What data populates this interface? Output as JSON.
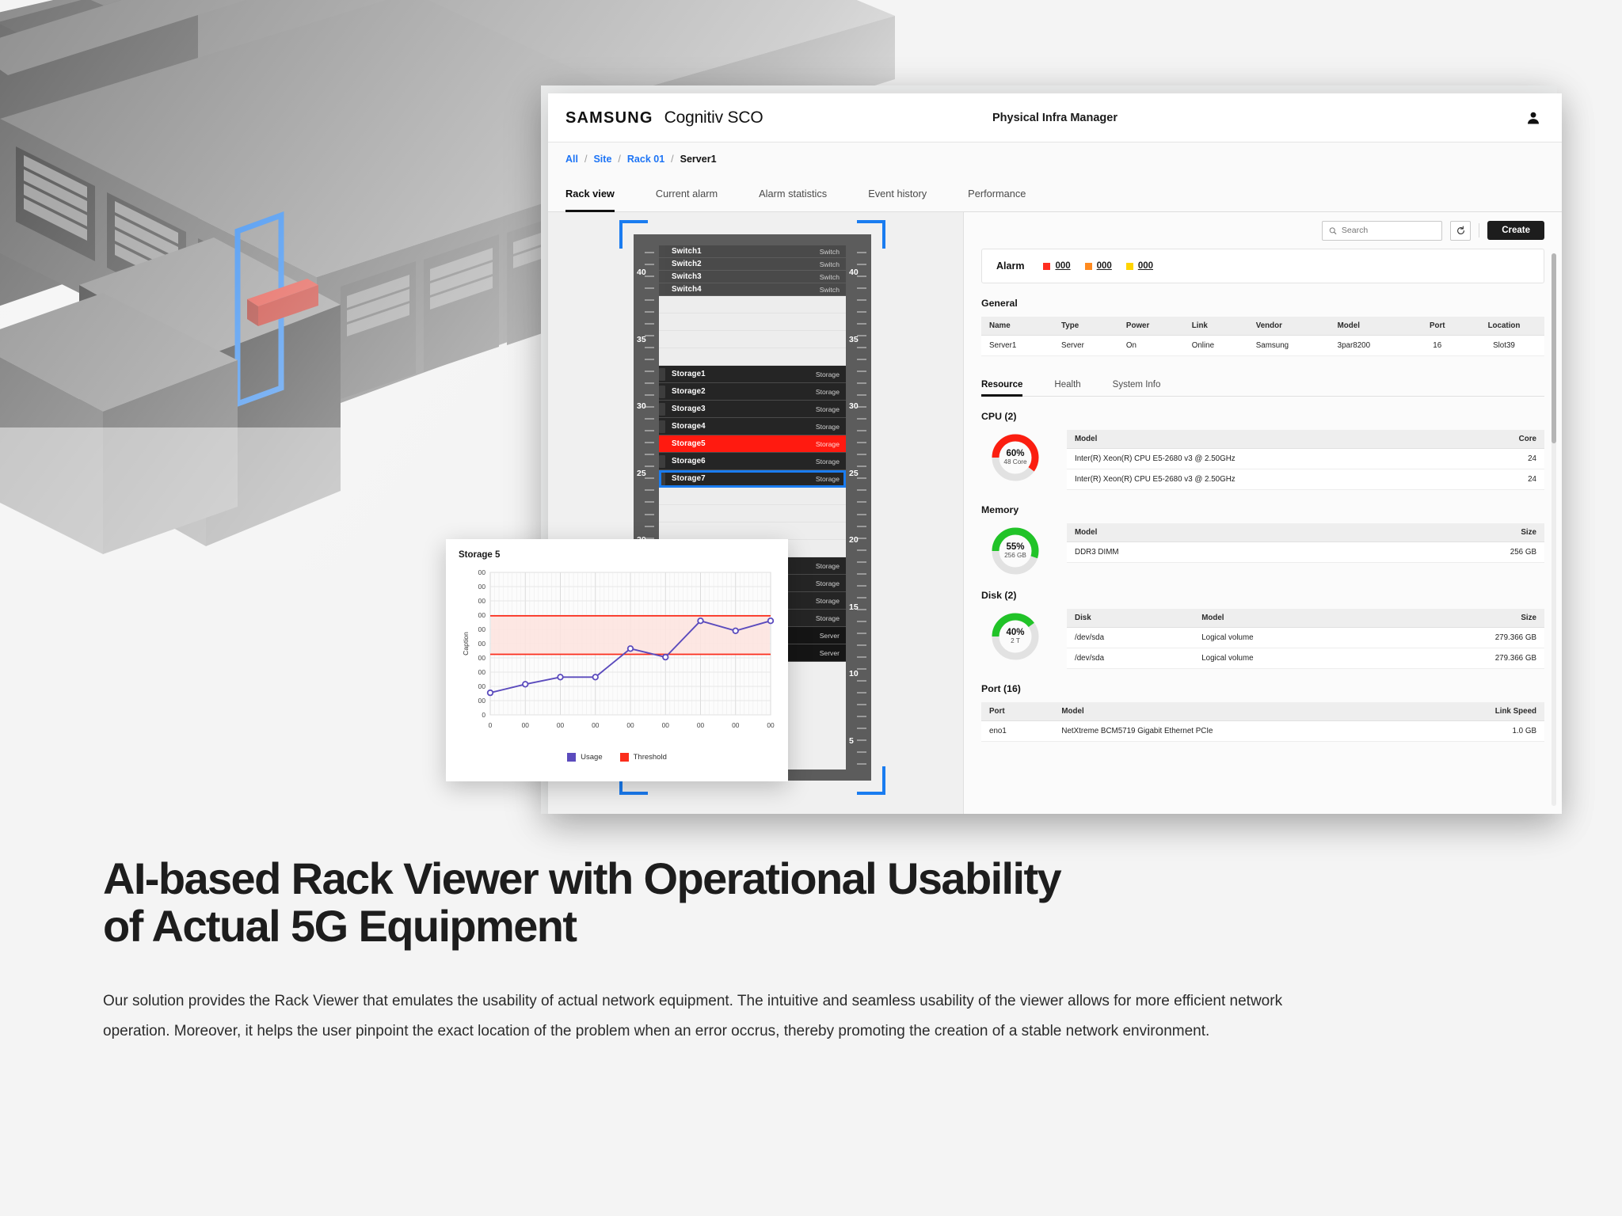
{
  "app": {
    "brand_samsung": "SAMSUNG",
    "brand_product": "Cognitiv SCO",
    "header_title": "Physical Infra Manager",
    "avatar_name": "user-avatar"
  },
  "breadcrumb": {
    "items": [
      "All",
      "Site",
      "Rack 01",
      "Server1"
    ],
    "separator": "/"
  },
  "tabs": [
    {
      "label": "Rack view",
      "active": true
    },
    {
      "label": "Current alarm",
      "active": false
    },
    {
      "label": "Alarm statistics",
      "active": false
    },
    {
      "label": "Event history",
      "active": false
    },
    {
      "label": "Performance",
      "active": false
    }
  ],
  "toolbar": {
    "search_placeholder": "Search",
    "search_value": "",
    "refresh_label": "↺",
    "create_label": "Create"
  },
  "alarm": {
    "title": "Alarm",
    "items": [
      {
        "color": "#ff2d20",
        "value": "000"
      },
      {
        "color": "#ff8a1f",
        "value": "000"
      },
      {
        "color": "#ffd400",
        "value": "000"
      }
    ]
  },
  "general": {
    "title": "General",
    "columns": [
      "Name",
      "Type",
      "Power",
      "Link",
      "Vendor",
      "Model",
      "Port",
      "Location"
    ],
    "rows": [
      [
        "Server1",
        "Server",
        "On",
        "Online",
        "Samsung",
        "3par8200",
        "16",
        "Slot39"
      ]
    ]
  },
  "subtabs": [
    {
      "label": "Resource",
      "active": true
    },
    {
      "label": "Health",
      "active": false
    },
    {
      "label": "System Info",
      "active": false
    }
  ],
  "cpu": {
    "title": "CPU (2)",
    "percent": "60%",
    "percent_value": 60,
    "sub": "48 Core",
    "ring_color": "#fb1e10",
    "columns": [
      "Model",
      "Core"
    ],
    "rows": [
      [
        "Inter(R) Xeon(R) CPU E5-2680 v3 @ 2.50GHz",
        "24"
      ],
      [
        "Inter(R) Xeon(R) CPU E5-2680 v3 @ 2.50GHz",
        "24"
      ]
    ]
  },
  "memory": {
    "title": "Memory",
    "percent": "55%",
    "percent_value": 55,
    "sub": "256 GB",
    "ring_color": "#21c328",
    "columns": [
      "Model",
      "Size"
    ],
    "rows": [
      [
        "DDR3 DIMM",
        "256 GB"
      ]
    ]
  },
  "disk": {
    "title": "Disk (2)",
    "percent": "40%",
    "percent_value": 40,
    "sub": "2 T",
    "ring_color": "#21c328",
    "columns": [
      "Disk",
      "Model",
      "Size"
    ],
    "rows": [
      [
        "/dev/sda",
        "Logical volume",
        "279.366 GB"
      ],
      [
        "/dev/sda",
        "Logical volume",
        "279.366 GB"
      ]
    ]
  },
  "port": {
    "title": "Port (16)",
    "columns": [
      "Port",
      "Model",
      "Link Speed"
    ],
    "rows": [
      [
        "eno1",
        "NetXtreme BCM5719 Gigabit Ethernet PCIe",
        "1.0 GB"
      ]
    ]
  },
  "rack": {
    "ruler_labels": [
      "40",
      "35",
      "30",
      "25",
      "20",
      "15",
      "10",
      "5"
    ],
    "units": [
      {
        "name": "Switch1",
        "type": "Switch",
        "state": "switch"
      },
      {
        "name": "Switch2",
        "type": "Switch",
        "state": "switch"
      },
      {
        "name": "Switch3",
        "type": "Switch",
        "state": "switch"
      },
      {
        "name": "Switch4",
        "type": "Switch",
        "state": "switch"
      },
      {
        "name": "",
        "type": "",
        "state": "empty"
      },
      {
        "name": "",
        "type": "",
        "state": "empty"
      },
      {
        "name": "",
        "type": "",
        "state": "empty"
      },
      {
        "name": "",
        "type": "",
        "state": "empty"
      },
      {
        "name": "Storage1",
        "type": "Storage",
        "state": "storage"
      },
      {
        "name": "Storage2",
        "type": "Storage",
        "state": "storage"
      },
      {
        "name": "Storage3",
        "type": "Storage",
        "state": "storage"
      },
      {
        "name": "Storage4",
        "type": "Storage",
        "state": "storage"
      },
      {
        "name": "Storage5",
        "type": "Storage",
        "state": "alarm"
      },
      {
        "name": "Storage6",
        "type": "Storage",
        "state": "storage"
      },
      {
        "name": "Storage7",
        "type": "Storage",
        "state": "selected"
      },
      {
        "name": "",
        "type": "",
        "state": "empty"
      },
      {
        "name": "",
        "type": "",
        "state": "empty"
      },
      {
        "name": "",
        "type": "",
        "state": "empty"
      },
      {
        "name": "",
        "type": "",
        "state": "empty"
      },
      {
        "name": "",
        "type": "Storage",
        "state": "storage"
      },
      {
        "name": "",
        "type": "Storage",
        "state": "storage"
      },
      {
        "name": "",
        "type": "Storage",
        "state": "storage"
      },
      {
        "name": "",
        "type": "Storage",
        "state": "storage"
      },
      {
        "name": "",
        "type": "Server",
        "state": "server"
      },
      {
        "name": "",
        "type": "Server",
        "state": "server"
      }
    ]
  },
  "chart_data": {
    "type": "line",
    "title": "Storage 5",
    "xlabel": "",
    "ylabel": "Caption",
    "grid": true,
    "legend_position": "bottom",
    "x": [
      "0",
      "00",
      "00",
      "00",
      "00",
      "00",
      "00",
      "00",
      "00"
    ],
    "y_ticks": [
      "00",
      "00",
      "00",
      "00",
      "00",
      "00",
      "00",
      "00",
      "00",
      "00",
      "0"
    ],
    "ylim": [
      0,
      10
    ],
    "series": [
      {
        "name": "Usage",
        "color": "#5b4bbd",
        "values": [
          1.55,
          2.15,
          2.65,
          2.65,
          4.65,
          4.05,
          6.6,
          5.9,
          6.6
        ]
      }
    ],
    "threshold": {
      "name": "Threshold",
      "color": "#fb2d1c",
      "upper": 6.95,
      "lower": 4.25,
      "band_color": "#fde3de"
    }
  },
  "footer": {
    "headline_line1": "AI-based Rack Viewer with Operational Usability",
    "headline_line2": "of Actual 5G Equipment",
    "body": "Our solution provides the Rack Viewer that emulates the usability of actual network equipment. The intuitive and seamless usability of the viewer allows for more efficient network operation. Moreover, it helps the user pinpoint the exact location of the problem when an error occrus, thereby promoting the creation of a stable network environment."
  }
}
